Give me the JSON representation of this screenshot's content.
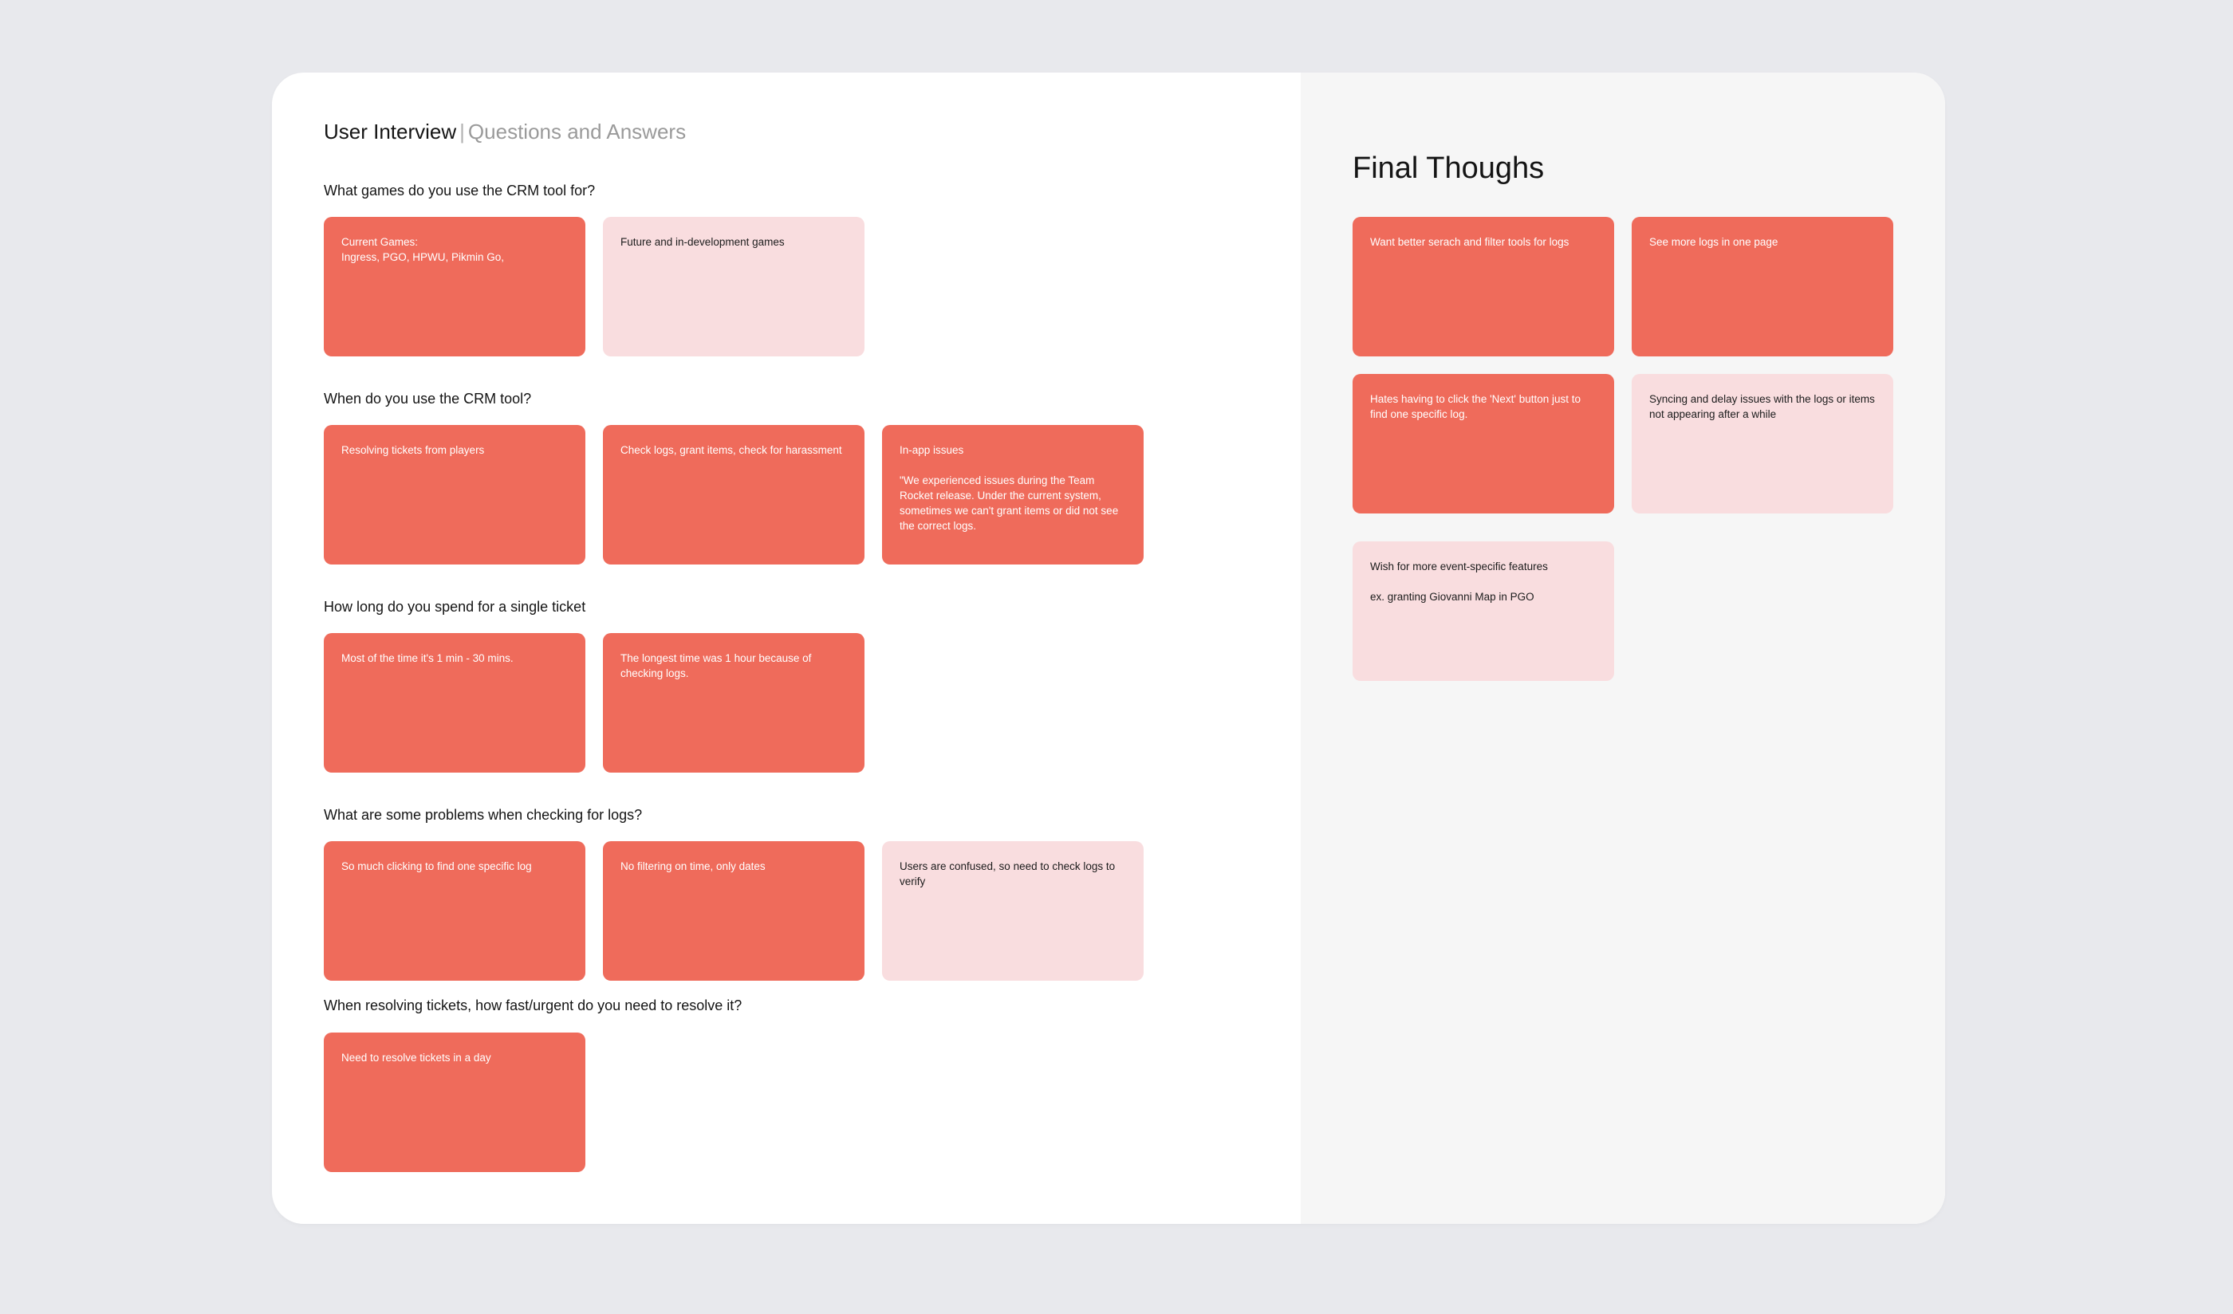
{
  "header": {
    "title": "User Interview",
    "separator": "|",
    "subtitle": "Questions and Answers"
  },
  "sections": [
    {
      "question": "What games do you use the CRM tool for?",
      "cards": [
        {
          "text": "Current Games:\nIngress, PGO, HPWU, Pikmin Go,",
          "color": "red"
        },
        {
          "text": "Future and in-development games",
          "color": "pink"
        }
      ]
    },
    {
      "question": "When do you use the CRM tool?",
      "cards": [
        {
          "text": "Resolving tickets from players",
          "color": "red"
        },
        {
          "text": "Check logs, grant items, check for harassment",
          "color": "red"
        },
        {
          "text": "In-app issues\n\n\"We experienced issues during the Team Rocket release. Under the current system, sometimes we can't grant items or did not see the correct logs.",
          "color": "red"
        }
      ]
    },
    {
      "question": "How long do you spend for a single ticket",
      "cards": [
        {
          "text": "Most of the time it's 1 min - 30 mins.",
          "color": "red"
        },
        {
          "text": "The longest time was 1 hour because of checking logs.",
          "color": "red"
        }
      ]
    },
    {
      "question": "What are some problems when checking for logs?",
      "cards": [
        {
          "text": "So much clicking to find one specific log",
          "color": "red"
        },
        {
          "text": "No filtering on time, only dates",
          "color": "red"
        },
        {
          "text": "Users are confused, so need to check logs to verify",
          "color": "pink"
        }
      ]
    },
    {
      "question": "When resolving tickets, how fast/urgent do you need to resolve it?",
      "cards": [
        {
          "text": "Need to resolve tickets in a day",
          "color": "red"
        }
      ]
    }
  ],
  "final": {
    "title": "Final Thoughs",
    "cards": [
      {
        "text": "Want better serach and filter tools for logs",
        "color": "red"
      },
      {
        "text": "See more logs in one page",
        "color": "red"
      },
      {
        "text": "Hates having to click the 'Next' button just to find one specific log.",
        "color": "red"
      },
      {
        "text": "Syncing and delay issues with the logs or items not appearing after a while",
        "color": "pink"
      },
      {
        "text": "Wish for more event-specific features\n\nex. granting Giovanni Map in PGO",
        "color": "pink"
      }
    ]
  },
  "colors": {
    "card_red": "#ef6b5b",
    "card_pink": "#f9dddf",
    "page_background": "#e8e9ed",
    "panel_background": "#f6f6f6"
  }
}
